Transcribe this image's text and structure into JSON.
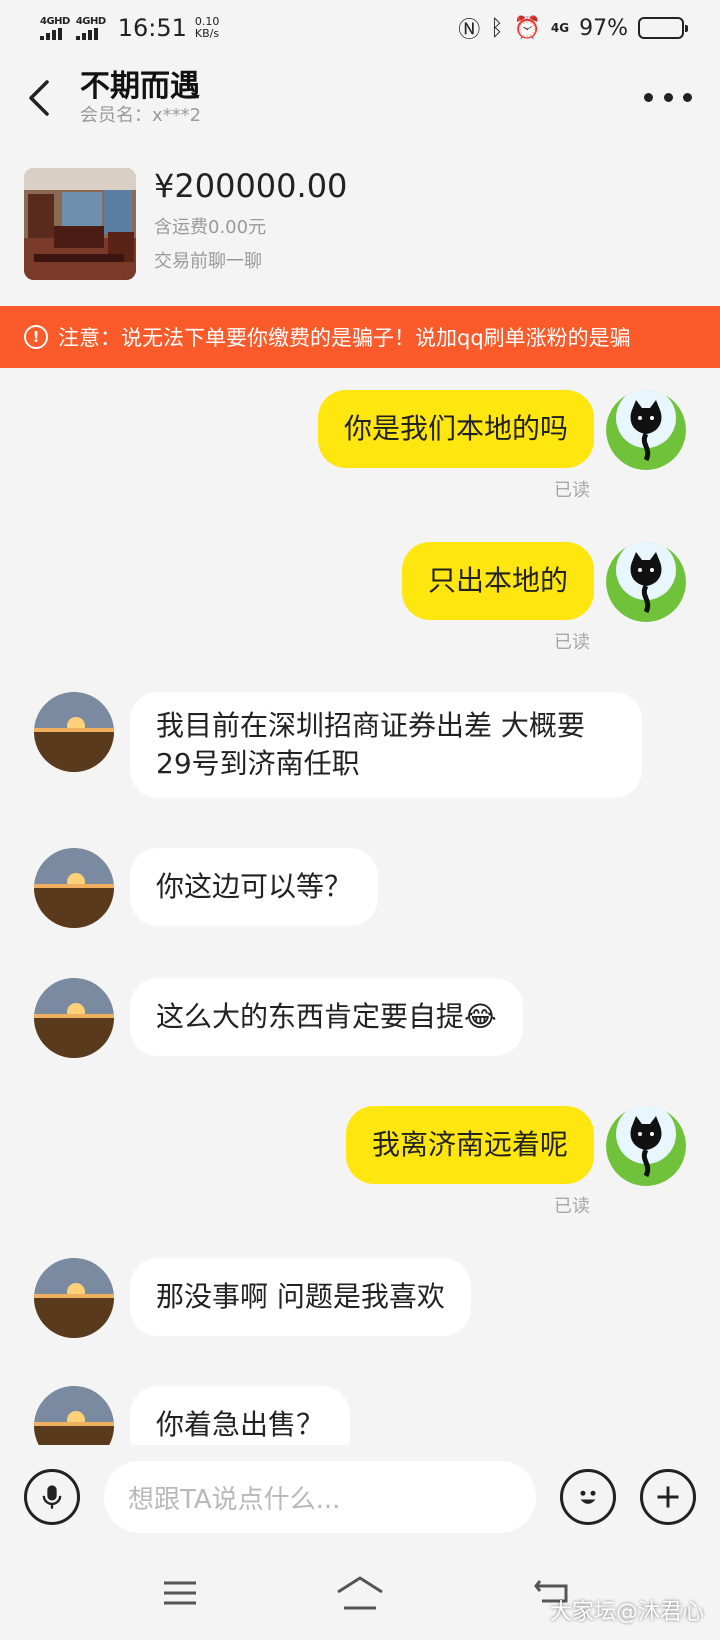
{
  "status_bar": {
    "signal_1": "4GHD",
    "signal_2": "4GHD",
    "time": "16:51",
    "speed_value": "0.10",
    "speed_unit": "KB/s",
    "net": "4G",
    "battery": "97%",
    "battery_level": 0.97
  },
  "header": {
    "title": "不期而遇",
    "member_label": "会员名：x***2"
  },
  "product": {
    "price": "¥200000.00",
    "shipping": "含运费0.00元",
    "note": "交易前聊一聊"
  },
  "warning": {
    "text": "注意：说无法下单要你缴费的是骗子！说加qq刷单涨粉的是骗"
  },
  "messages": [
    {
      "side": "out",
      "text": "你是我们本地的吗",
      "read": "已读"
    },
    {
      "side": "out",
      "text": "只出本地的",
      "read": "已读"
    },
    {
      "side": "in",
      "text": "我目前在深圳招商证券出差  大概要29号到济南任职"
    },
    {
      "side": "in",
      "text": "你这边可以等？"
    },
    {
      "side": "in",
      "text": "这么大的东西肯定要自提😂"
    },
    {
      "side": "out",
      "text": "我离济南远着呢",
      "read": "已读"
    },
    {
      "side": "in",
      "text": " 那没事啊  问题是我喜欢"
    },
    {
      "side": "in",
      "text": "你着急出售？"
    }
  ],
  "input": {
    "placeholder": "想跟TA说点什么..."
  },
  "icons": {
    "back": "back-arrow-icon",
    "more": "more-dots-icon",
    "warning": "alert-circle-icon",
    "voice": "microphone-icon",
    "emoji": "emoji-icon",
    "add": "plus-icon",
    "nav_menu": "menu-icon",
    "nav_home": "home-icon",
    "nav_back": "back-nav-icon"
  },
  "colors": {
    "outgoing_bubble": "#ffe60f",
    "warning_banner": "#fb5b2a",
    "background": "#f4f4f4"
  },
  "watermark": "大家坛@沐君心"
}
